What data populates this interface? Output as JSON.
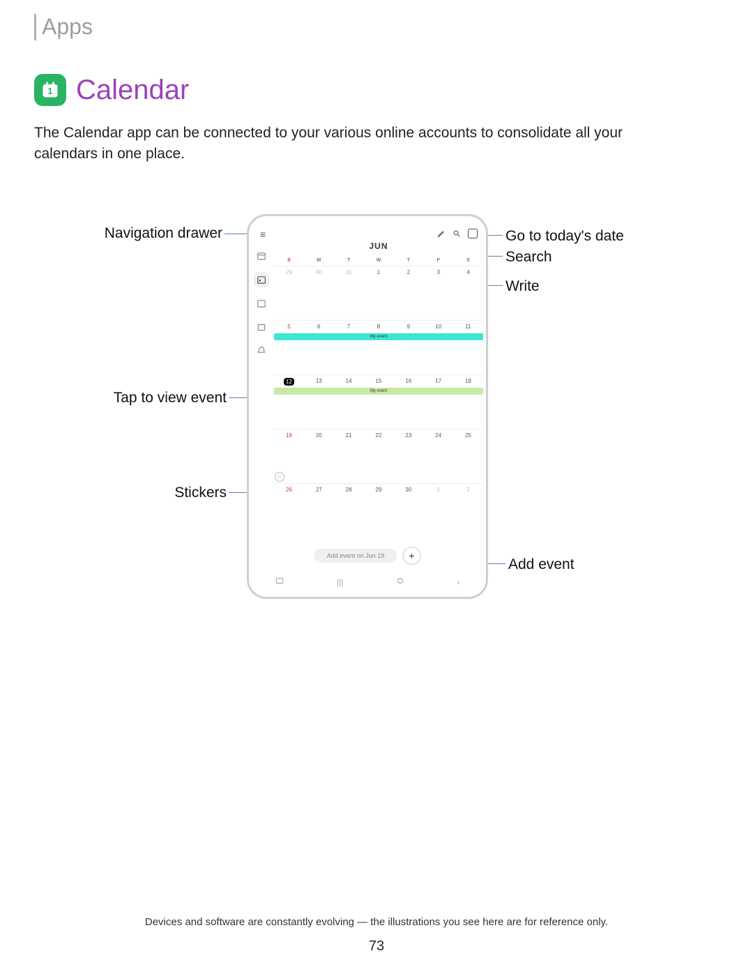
{
  "header": {
    "section": "Apps"
  },
  "title": "Calendar",
  "intro": "The Calendar app can be connected to your various online accounts to consolidate all your calendars in one place.",
  "callouts": {
    "navigation_drawer": "Navigation drawer",
    "tap_view_event": "Tap to view event",
    "stickers": "Stickers",
    "go_today": "Go to today's date",
    "search": "Search",
    "write": "Write",
    "add_event": "Add event"
  },
  "device": {
    "month": "JUN",
    "dow": [
      "S",
      "M",
      "T",
      "W",
      "T",
      "F",
      "S"
    ],
    "weeks": [
      {
        "dates": [
          "29",
          "30",
          "31",
          "1",
          "2",
          "3",
          "4"
        ],
        "faded": [
          0,
          1,
          2
        ],
        "event": null
      },
      {
        "dates": [
          "5",
          "6",
          "7",
          "8",
          "9",
          "10",
          "11"
        ],
        "faded": [],
        "event": {
          "label": "My event",
          "color": "cyan"
        }
      },
      {
        "dates": [
          "12",
          "13",
          "14",
          "15",
          "16",
          "17",
          "18"
        ],
        "faded": [],
        "today_index": 0,
        "event": {
          "label": "My event",
          "color": "green"
        }
      },
      {
        "dates": [
          "19",
          "20",
          "21",
          "22",
          "23",
          "24",
          "25"
        ],
        "faded": [],
        "event": null,
        "sticker": true
      },
      {
        "dates": [
          "26",
          "27",
          "28",
          "29",
          "30",
          "1",
          "2"
        ],
        "faded": [
          5,
          6
        ],
        "event": null
      }
    ],
    "add_pill": "Add event on Jun 19"
  },
  "footer": {
    "disclaimer": "Devices and software are constantly evolving — the illustrations you see here are for reference only.",
    "page": "73"
  }
}
